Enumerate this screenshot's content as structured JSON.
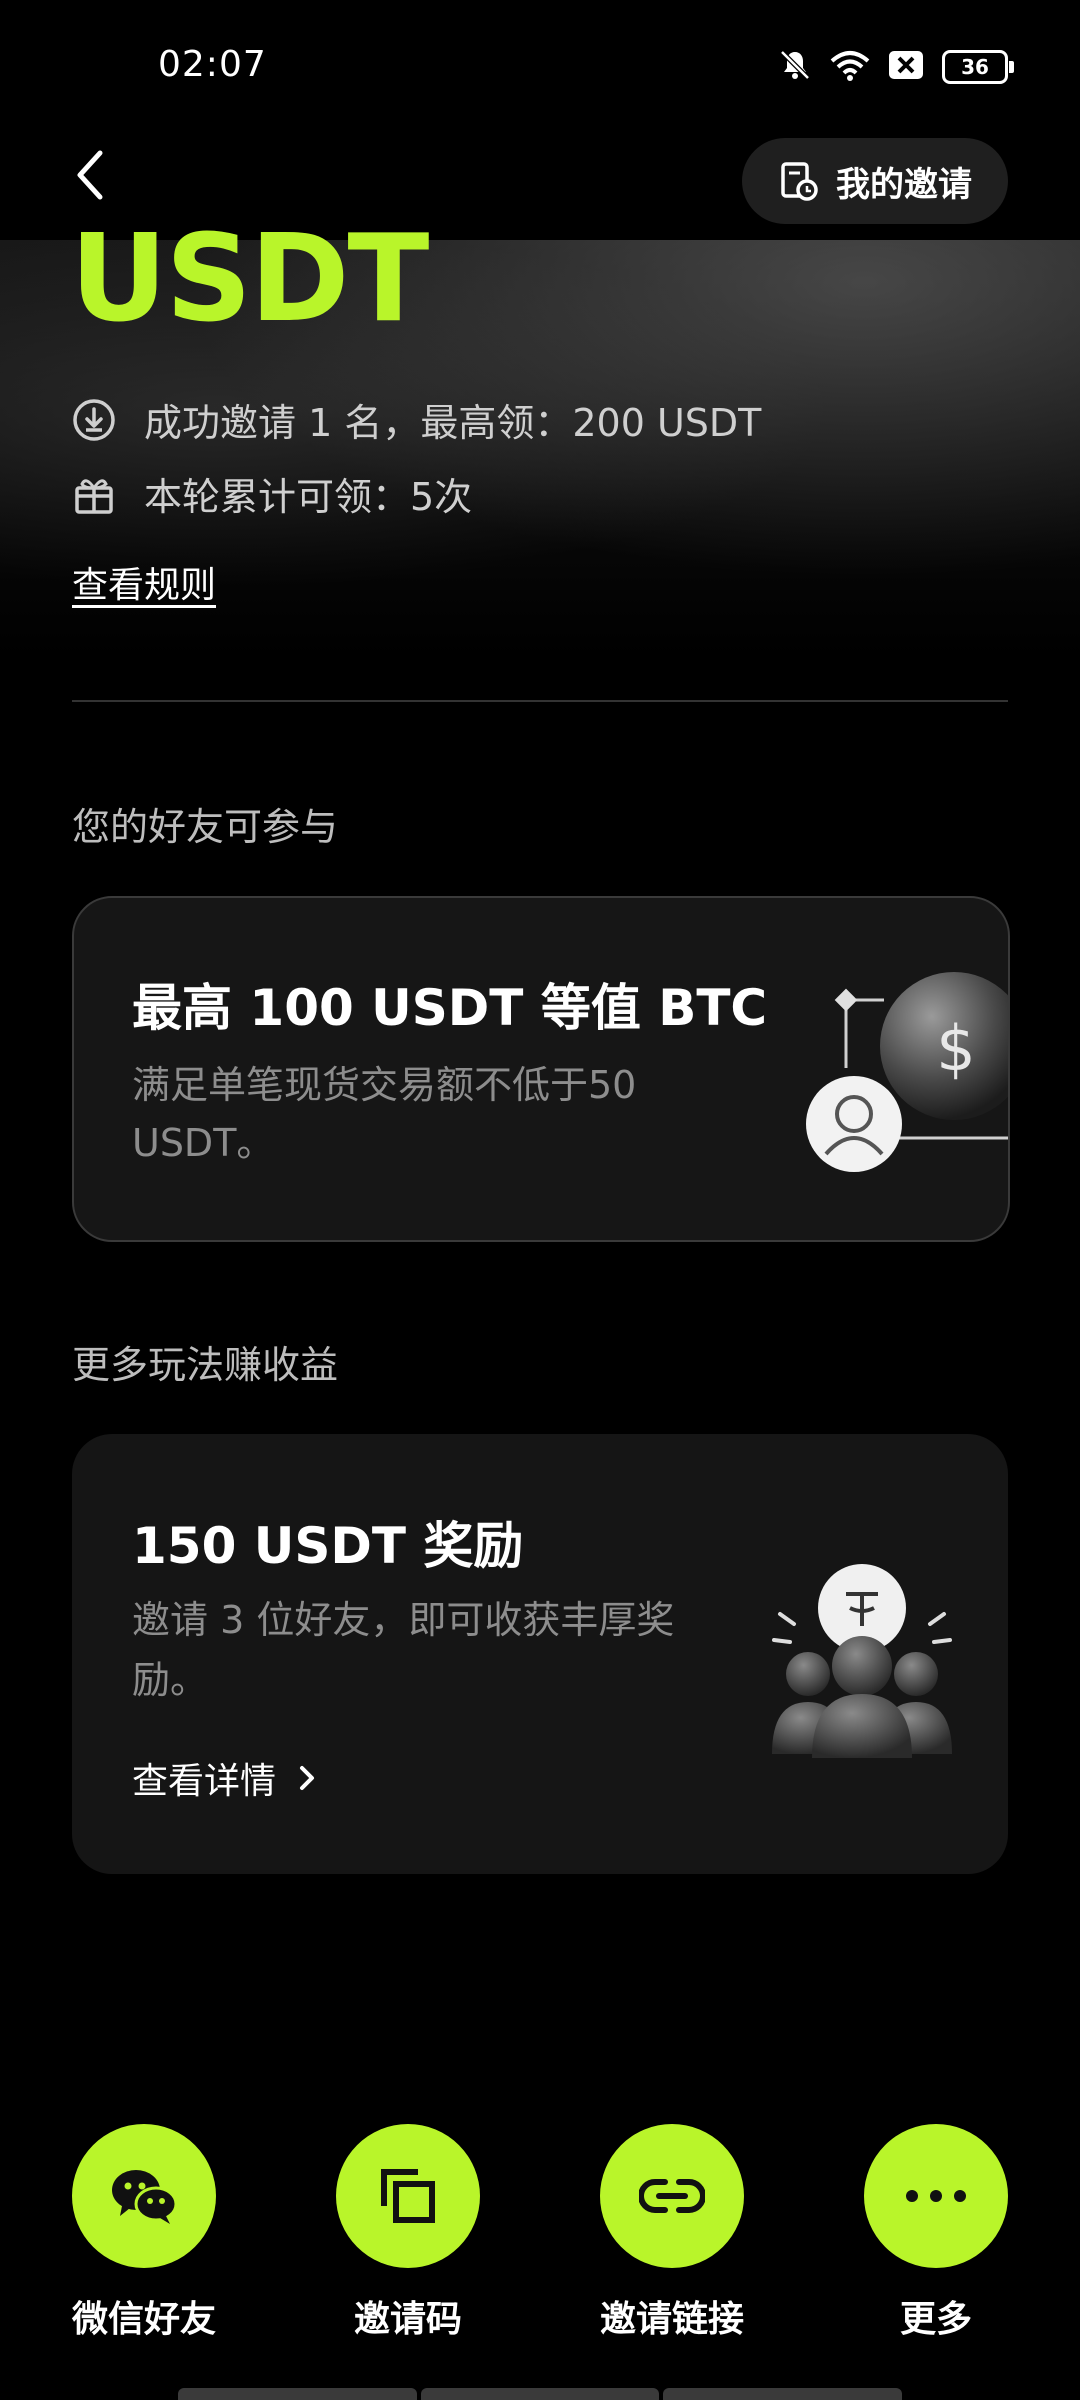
{
  "status_bar": {
    "time": "02:07",
    "battery": "36",
    "icons": [
      "bell-muted-icon",
      "wifi-icon",
      "sim-blocked-icon",
      "battery-icon"
    ]
  },
  "header": {
    "my_invite_label": "我的邀请"
  },
  "hero": {
    "title": "USDT",
    "info": [
      {
        "icon": "download-icon",
        "text": "成功邀请 1 名，最高领：200 USDT"
      },
      {
        "icon": "gift-icon",
        "text": "本轮累计可领：5次"
      }
    ],
    "rules_link": "查看规则"
  },
  "friend_section": {
    "title": "您的好友可参与",
    "card": {
      "title": "最高 100 USDT 等值 BTC",
      "desc": "满足单笔现货交易额不低于50 USDT。"
    }
  },
  "more_section": {
    "title": "更多玩法赚收益",
    "card": {
      "title": "150 USDT 奖励",
      "desc": "邀请 3 位好友，即可收获丰厚奖励。",
      "link": "查看详情"
    }
  },
  "share": [
    {
      "label": "微信好友",
      "icon": "wechat-icon"
    },
    {
      "label": "邀请码",
      "icon": "copy-icon"
    },
    {
      "label": "邀请链接",
      "icon": "link-icon"
    },
    {
      "label": "更多",
      "icon": "more-icon"
    }
  ],
  "colors": {
    "accent": "#b9f52a",
    "background": "#000000",
    "card": "#161616",
    "muted_text": "#8d8d8d"
  }
}
